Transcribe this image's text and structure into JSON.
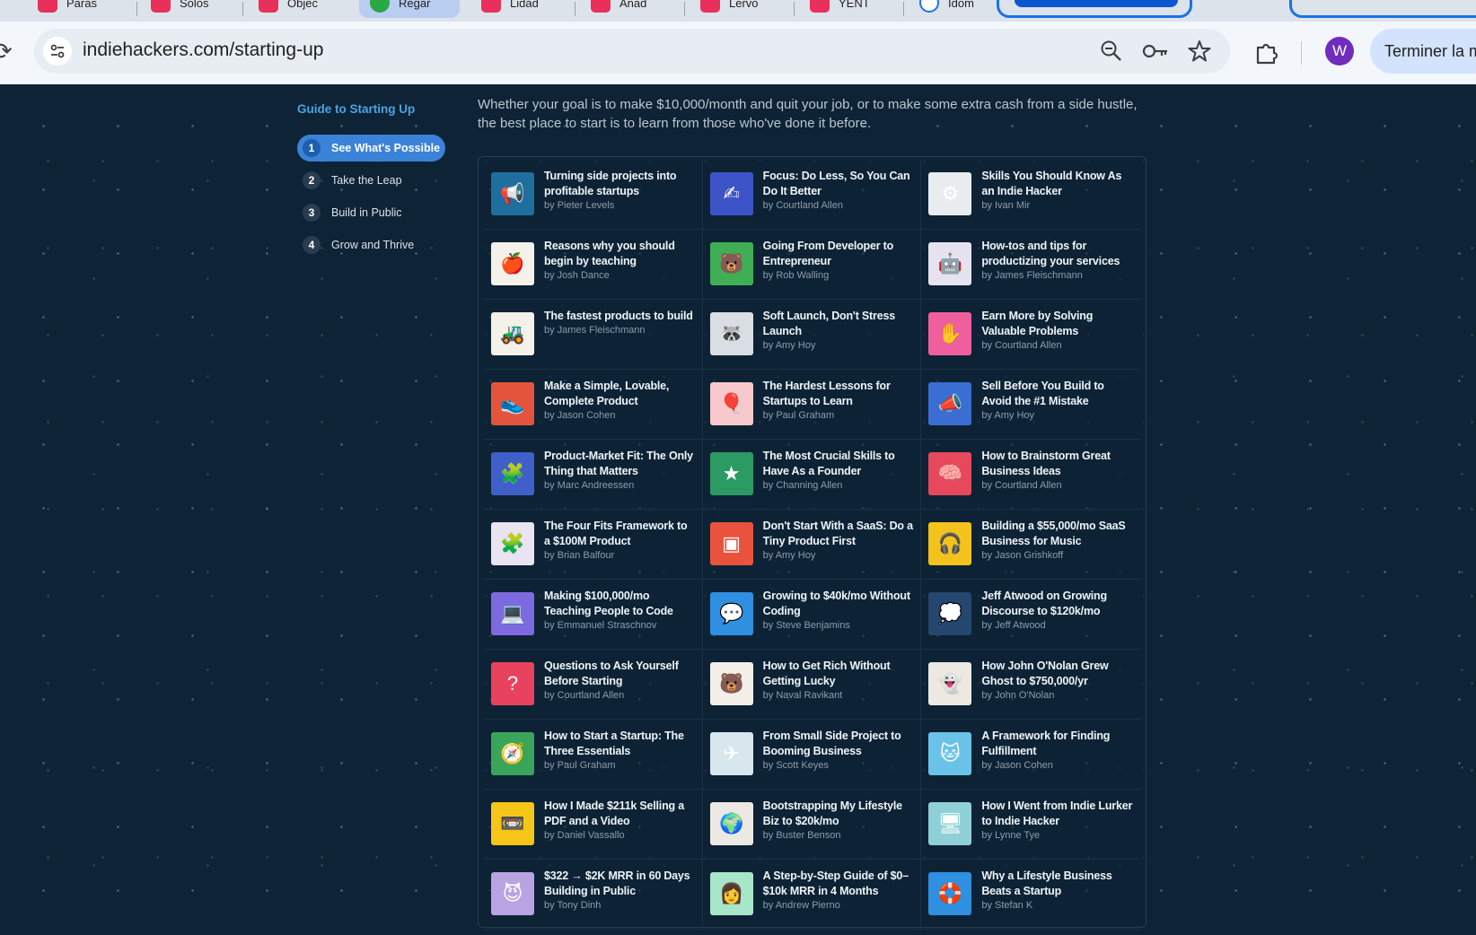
{
  "browser": {
    "tabs": [
      {
        "label": "Paras",
        "icon": "app-icon"
      },
      {
        "label": "Solos",
        "icon": "app-icon"
      },
      {
        "label": "Objec",
        "icon": "app-icon"
      },
      {
        "label": "Regar",
        "icon": "green-icon"
      },
      {
        "label": "Lidad",
        "icon": "app-icon"
      },
      {
        "label": "Anad",
        "icon": "app-icon"
      },
      {
        "label": "Lervo",
        "icon": "app-icon"
      },
      {
        "label": "YENT",
        "icon": "app-icon"
      },
      {
        "label": "Idom",
        "icon": "google-icon"
      }
    ],
    "url": "indiehackers.com/starting-up",
    "avatar_letter": "W",
    "finish_label": "Terminer la m"
  },
  "sidebar": {
    "title": "Guide to Starting Up",
    "steps": [
      {
        "num": "1",
        "label": "See What's Possible",
        "active": true
      },
      {
        "num": "2",
        "label": "Take the Leap"
      },
      {
        "num": "3",
        "label": "Build in Public"
      },
      {
        "num": "4",
        "label": "Grow and Thrive"
      }
    ]
  },
  "main": {
    "intro": "Whether your goal is to make $10,000/month and quit your job, or to make some extra cash from a side hustle, the best place to start is to learn from those who've done it before.",
    "cards": [
      {
        "title": "Turning side projects into profitable startups",
        "author": "by Pieter Levels",
        "color": "#1f6f9e",
        "icon": "📢"
      },
      {
        "title": "Focus: Do Less, So You Can Do It Better",
        "author": "by Courtland Allen",
        "color": "#3d54c9",
        "icon": "✍"
      },
      {
        "title": "Skills You Should Know As an Indie Hacker",
        "author": "by Ivan Mir",
        "color": "#e9ecef",
        "icon": "⚙"
      },
      {
        "title": "Reasons why you should begin by teaching",
        "author": "by Josh Dance",
        "color": "#f4f1ea",
        "icon": "🍎"
      },
      {
        "title": "Going From Developer to Entrepreneur",
        "author": "by Rob Walling",
        "color": "#3fae54",
        "icon": "🐻"
      },
      {
        "title": "How-tos and tips for productizing your services",
        "author": "by James Fleischmann",
        "color": "#e7e2ef",
        "icon": "🤖"
      },
      {
        "title": "The fastest products to build",
        "author": "by James Fleischmann",
        "color": "#f4f1ea",
        "icon": "🚜"
      },
      {
        "title": "Soft Launch, Don't Stress Launch",
        "author": "by Amy Hoy",
        "color": "#d9dee4",
        "icon": "🦝"
      },
      {
        "title": "Earn More by Solving Valuable Problems",
        "author": "by Courtland Allen",
        "color": "#ef5f9e",
        "icon": "✋"
      },
      {
        "title": "Make a Simple, Lovable, Complete Product",
        "author": "by Jason Cohen",
        "color": "#e4543d",
        "icon": "👟"
      },
      {
        "title": "The Hardest Lessons for Startups to Learn",
        "author": "by Paul Graham",
        "color": "#f7c9cd",
        "icon": "🎈"
      },
      {
        "title": "Sell Before You Build to Avoid the #1 Mistake",
        "author": "by Amy Hoy",
        "color": "#3b6ed2",
        "icon": "📣"
      },
      {
        "title": "Product-Market Fit: The Only Thing that Matters",
        "author": "by Marc Andreessen",
        "color": "#3f5fc9",
        "icon": "🧩"
      },
      {
        "title": "The Most Crucial Skills to Have As a Founder",
        "author": "by Channing Allen",
        "color": "#2c9a63",
        "icon": "★"
      },
      {
        "title": "How to Brainstorm Great Business Ideas",
        "author": "by Courtland Allen",
        "color": "#e5495b",
        "icon": "🧠"
      },
      {
        "title": "The Four Fits Framework to a $100M Product",
        "author": "by Brian Balfour",
        "color": "#e9e3f2",
        "icon": "🧩"
      },
      {
        "title": "Don't Start With a SaaS: Do a Tiny Product First",
        "author": "by Amy Hoy",
        "color": "#e9533d",
        "icon": "▣"
      },
      {
        "title": "Building a $55,000/mo SaaS Business for Music",
        "author": "by Jason Grishkoff",
        "color": "#f3c21d",
        "icon": "🎧"
      },
      {
        "title": "Making $100,000/mo Teaching People to Code",
        "author": "by Emmanuel Straschnov",
        "color": "#7e6ae0",
        "icon": "💻"
      },
      {
        "title": "Growing to $40k/mo Without Coding",
        "author": "by Steve Benjamins",
        "color": "#2f8fe0",
        "icon": "💬"
      },
      {
        "title": "Jeff Atwood on Growing Discourse to $120k/mo",
        "author": "by Jeff Atwood",
        "color": "#25466f",
        "icon": "💭"
      },
      {
        "title": "Questions to Ask Yourself Before Starting",
        "author": "by Courtland Allen",
        "color": "#e8425e",
        "icon": "?"
      },
      {
        "title": "How to Get Rich Without Getting Lucky",
        "author": "by Naval Ravikant",
        "color": "#f4efe8",
        "icon": "🐻"
      },
      {
        "title": "How John O'Nolan Grew Ghost to $750,000/yr",
        "author": "by John O'Nolan",
        "color": "#ece8e2",
        "icon": "👻"
      },
      {
        "title": "How to Start a Startup: The Three Essentials",
        "author": "by Paul Graham",
        "color": "#3aa55a",
        "icon": "🧭"
      },
      {
        "title": "From Small Side Project to Booming Business",
        "author": "by Scott Keyes",
        "color": "#d8e6ee",
        "icon": "✈"
      },
      {
        "title": "A Framework for Finding Fulfillment",
        "author": "by Jason Cohen",
        "color": "#6bc2e8",
        "icon": "🐱"
      },
      {
        "title": "How I Made $211k Selling a PDF and a Video",
        "author": "by Daniel Vassallo",
        "color": "#f5c518",
        "icon": "📼"
      },
      {
        "title": "Bootstrapping My Lifestyle Biz to $20k/mo",
        "author": "by Buster Benson",
        "color": "#ece9e4",
        "icon": "🌍"
      },
      {
        "title": "How I Went from Indie Lurker to Indie Hacker",
        "author": "by Lynne Tye",
        "color": "#8fd0d6",
        "icon": "🖥"
      },
      {
        "title": "$322 → $2K MRR in 60 Days Building in Public",
        "author": "by Tony Dinh",
        "color": "#b9a3e3",
        "icon": "😈"
      },
      {
        "title": "A Step-by-Step Guide of $0–$10k MRR in 4 Months",
        "author": "by Andrew Pierno",
        "color": "#a7e6c8",
        "icon": "👩"
      },
      {
        "title": "Why a Lifestyle Business Beats a Startup",
        "author": "by Stefan K",
        "color": "#2f8fe0",
        "icon": "🛟"
      }
    ]
  }
}
